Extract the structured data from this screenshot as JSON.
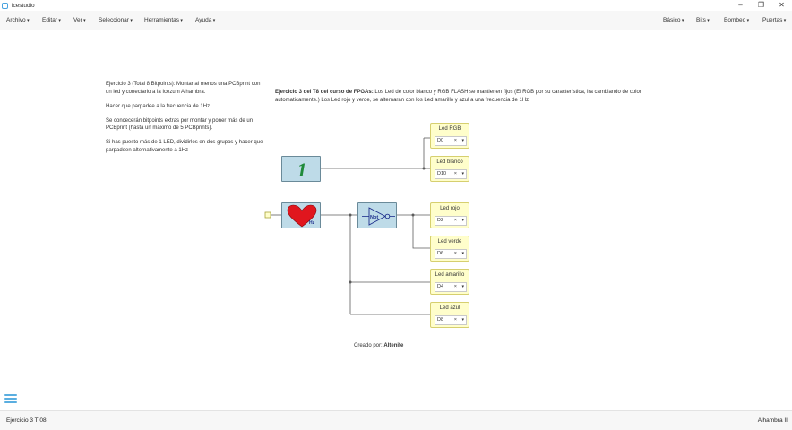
{
  "window": {
    "title": "icestudio",
    "minimize": "–",
    "maximize": "❐",
    "close": "✕"
  },
  "menu_left": [
    "Archivo",
    "Editar",
    "Ver",
    "Seleccionar",
    "Herramientas",
    "Ayuda"
  ],
  "menu_right": [
    "Básico",
    "Bits",
    "Bombeo",
    "Puertas"
  ],
  "notes": [
    "Ejercicio 3 (Total 8 Bitpoints): Montar al menos una PCBprint con un led y conectarlo a la Icezum Alhambra.",
    "Hacer que parpadee a la frecuencia de 1Hz.",
    "Se concecerán bitpoints extras por montar y poner más de un PCBprint (hasta un máximo de 5 PCBprints).",
    "Si has puesto más de 1 LED, dividirlos en dos grupos y hacer que parpadeen alternativamente a 1Hz"
  ],
  "info": {
    "title": "Ejercicio 3 del T8 del curso de FPGAs:",
    "text": " Los Led de color blanco y RGB FLASH se mantienen fijos (El RGB por su característica, ira cambiando de color automaticamente.) Los Led rojo y verde, se alternaran con los Led amarillo y azul a una frecuencia de 1Hz"
  },
  "blocks": {
    "const_label": "1",
    "heart_label": "Hz",
    "not_label": "Not"
  },
  "leds": [
    {
      "label": "Led RGB",
      "pin": "D0"
    },
    {
      "label": "Led blanco",
      "pin": "D10"
    },
    {
      "label": "Led rojo",
      "pin": "D2"
    },
    {
      "label": "Led verde",
      "pin": "D6"
    },
    {
      "label": "Led amarillo",
      "pin": "D4"
    },
    {
      "label": "Led azul",
      "pin": "D8"
    }
  ],
  "credit": {
    "prefix": "Creado por: ",
    "author": "Altenife"
  },
  "status": {
    "left": "Ejercicio 3 T 08",
    "right": "Alhambra II"
  },
  "colors": {
    "block_fill": "#bedbe8",
    "led_fill": "#fffecb",
    "heart": "#e0161e",
    "accent": "#5aaee0"
  }
}
